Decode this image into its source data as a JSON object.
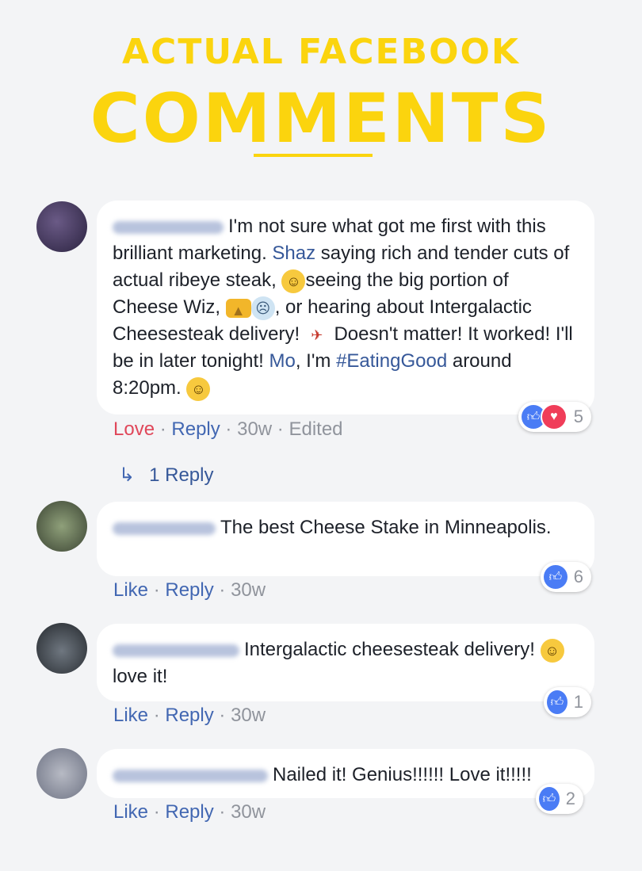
{
  "header": {
    "line1": "ACTUAL FACEBOOK",
    "line2": "COMMENTS"
  },
  "comments": [
    {
      "text_parts": {
        "p1": "I'm not sure what got me first with this brilliant marketing. ",
        "mention1": "Shaz",
        "p2": " saying rich and tender cuts of actual ribeye steak, ",
        "p3": "seeing the big portion of Cheese Wiz, ",
        "p4": ", or hearing about Intergalactic Cheesesteak delivery! ",
        "p5": " Doesn't matter! It worked! I'll be in later tonight! ",
        "mention2": "Mo",
        "p6": ", I'm ",
        "hashtag": "#EatingGood",
        "p7": " around 8:20pm. "
      },
      "action": "Love",
      "reply": "Reply",
      "time": "30w",
      "edited": "Edited",
      "reactions": [
        "like-icon",
        "love-icon"
      ],
      "reaction_count": "5"
    },
    {
      "text": "The best Cheese Stake in Minneapolis.",
      "action": "Like",
      "reply": "Reply",
      "time": "30w",
      "reactions": [
        "like-icon"
      ],
      "reaction_count": "6"
    },
    {
      "text_a": "Intergalactic cheesesteak delivery! ",
      "text_b": " love it!",
      "action": "Like",
      "reply": "Reply",
      "time": "30w",
      "reactions": [
        "like-icon"
      ],
      "reaction_count": "1"
    },
    {
      "text": "Nailed it! Genius!!!!!! Love it!!!!!",
      "action": "Like",
      "reply": "Reply",
      "time": "30w",
      "reactions": [
        "like-icon"
      ],
      "reaction_count": "2"
    }
  ],
  "replies_link": "1 Reply",
  "separator": "·",
  "colors": {
    "accent_yellow": "#fbd40e",
    "link_blue": "#365899",
    "love_red": "#e0475a"
  }
}
